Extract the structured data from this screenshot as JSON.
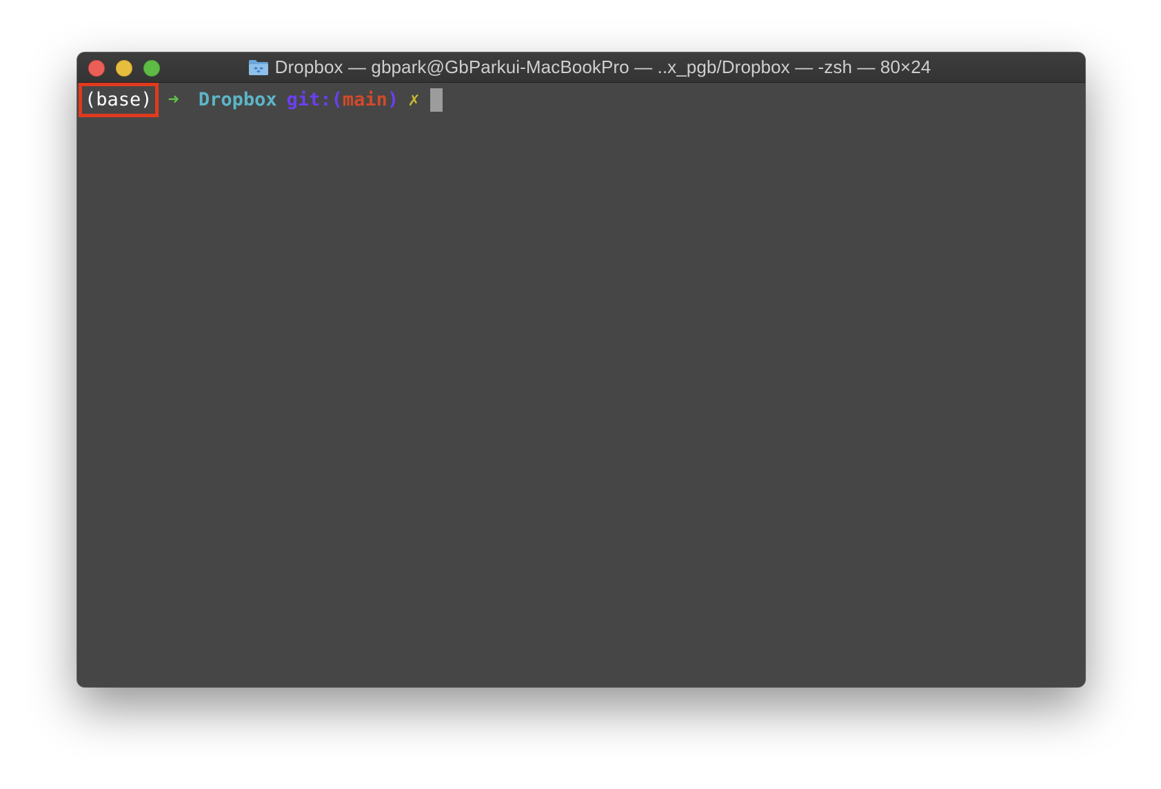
{
  "window": {
    "title": "Dropbox — gbpark@GbParkui-MacBookPro — ..x_pgb/Dropbox — -zsh — 80×24",
    "title_icon": "folder-icon"
  },
  "terminal": {
    "env": "(base)",
    "arrow": "➜",
    "directory": "Dropbox",
    "git_prefix": "git:(",
    "branch": "main",
    "git_suffix": ")",
    "dirty_marker": "✗"
  },
  "colors": {
    "background": "#464646",
    "highlight_box": "#e03a1e",
    "arrow": "#5fc24a",
    "directory": "#5cb6c8",
    "git": "#6a40f0",
    "branch": "#d14a2a",
    "dirty": "#c7b832"
  }
}
